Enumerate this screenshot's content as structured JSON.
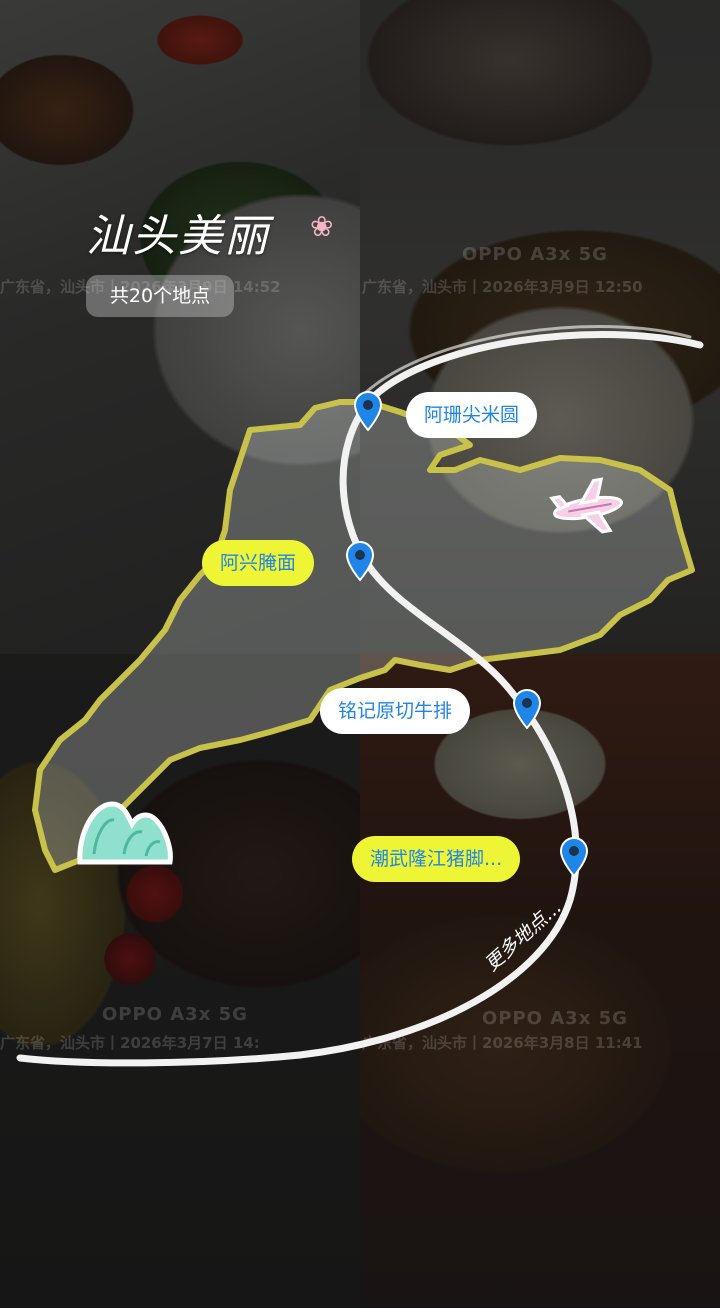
{
  "title": "汕头美丽",
  "place_count": "共20个地点",
  "watermarks": {
    "model": "OPPO A3x 5G",
    "tl_location": "广东省，汕头市丨2026年3月9日 14:52",
    "tr_location": "广东省，汕头市丨2026年3月9日 12:50",
    "bl_location": "广东省，汕头市丨2026年3月7日 14:",
    "br_location": "广东省，汕头市丨2026年3月8日 11:41"
  },
  "places": [
    {
      "name": "阿珊尖米圆",
      "style": "white"
    },
    {
      "name": "阿兴腌面",
      "style": "yellow"
    },
    {
      "name": "铭记原切牛排",
      "style": "white"
    },
    {
      "name": "潮武隆江猪脚...",
      "style": "yellow"
    }
  ],
  "more_places": "更多地点...",
  "colors": {
    "pin": "#1f86e8",
    "pill_text": "#1f86e8",
    "pill_yellow": "#eef534",
    "map_outline": "#c9c24a",
    "route": "#ffffff"
  },
  "icons": [
    "flower-icon",
    "airplane-icon",
    "mountain-icon",
    "map-pin-icon"
  ]
}
